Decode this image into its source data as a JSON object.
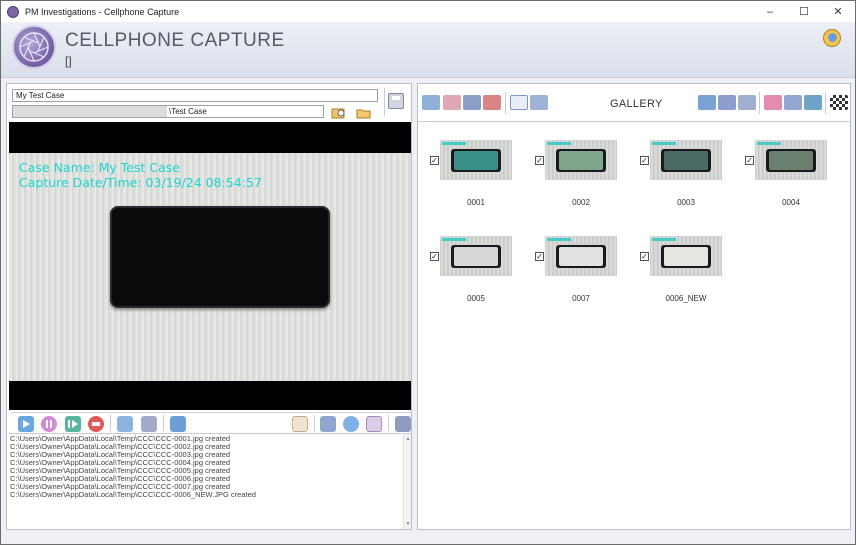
{
  "window": {
    "title": "PM Investigations  -  Cellphone Capture",
    "minimize": "–",
    "maximize": "☐",
    "close": "✕"
  },
  "header": {
    "title": "CELLPHONE CAPTURE",
    "subtitle": "[]"
  },
  "case": {
    "name_value": "My Test Case",
    "path_value": "\\Test Case"
  },
  "preview": {
    "overlay_case": "Case Name: My Test Case",
    "overlay_date": "Capture Date/Time: 03/19/24 08:54:57"
  },
  "log": {
    "lines": [
      "C:\\Users\\Owner\\AppData\\Local\\Temp\\CCC\\CCC-0001.jpg created",
      "C:\\Users\\Owner\\AppData\\Local\\Temp\\CCC\\CCC-0002.jpg created",
      "C:\\Users\\Owner\\AppData\\Local\\Temp\\CCC\\CCC-0003.jpg created",
      "C:\\Users\\Owner\\AppData\\Local\\Temp\\CCC\\CCC-0004.jpg created",
      "C:\\Users\\Owner\\AppData\\Local\\Temp\\CCC\\CCC-0005.jpg created",
      "C:\\Users\\Owner\\AppData\\Local\\Temp\\CCC\\CCC-0006.jpg created",
      "C:\\Users\\Owner\\AppData\\Local\\Temp\\CCC\\CCC-0007.jpg created",
      "C:\\Users\\Owner\\AppData\\Local\\Temp\\CCC\\CCC-0006_NEW.JPG created"
    ]
  },
  "gallery": {
    "title": "GALLERY",
    "items": [
      {
        "label": "0001",
        "checked": "✓",
        "screen": "#3a8f8a"
      },
      {
        "label": "0002",
        "checked": "✓",
        "screen": "#7fa58c"
      },
      {
        "label": "0003",
        "checked": "✓",
        "screen": "#4b6a63"
      },
      {
        "label": "0004",
        "checked": "✓",
        "screen": "#6c7f6e"
      },
      {
        "label": "0005",
        "checked": "✓",
        "screen": "#d5d8d4"
      },
      {
        "label": "0007",
        "checked": "✓",
        "screen": "#dfe2de"
      },
      {
        "label": "0006_NEW",
        "checked": "✓",
        "screen": "#e4e6e2"
      }
    ]
  },
  "colors": {
    "accent": "#7a66aa",
    "overlay_text": "#1fd3d0",
    "background": "#eef0f5"
  }
}
